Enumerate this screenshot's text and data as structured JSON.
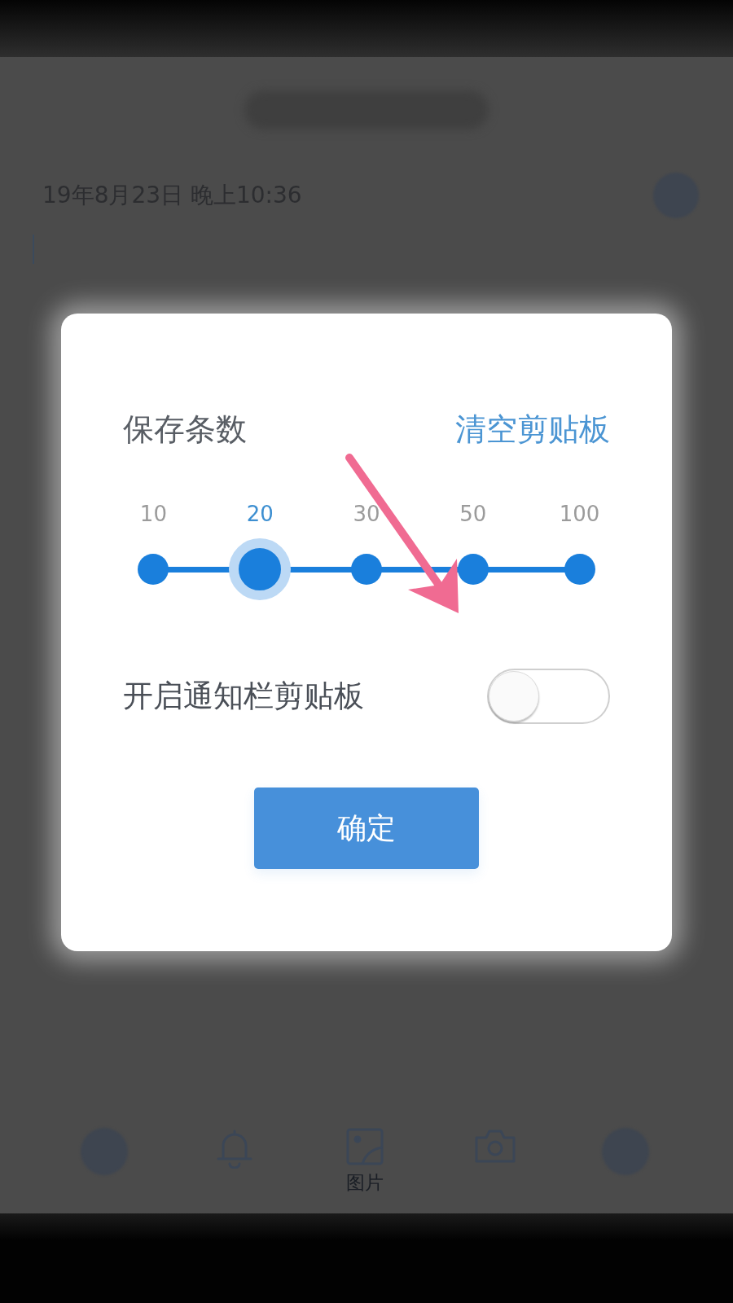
{
  "page": {
    "timestamp": "19年8月23日 晚上10:36"
  },
  "dialog": {
    "title": "保存条数",
    "clear_link": "清空剪贴板",
    "slider": {
      "options": [
        {
          "label": "10",
          "selected": false
        },
        {
          "label": "20",
          "selected": true
        },
        {
          "label": "30",
          "selected": false
        },
        {
          "label": "50",
          "selected": false
        },
        {
          "label": "100",
          "selected": false
        }
      ]
    },
    "notification_toggle": {
      "label": "开启通知栏剪贴板",
      "on": false
    },
    "confirm_button": "确定"
  },
  "bottom_toolbar": {
    "image_label": "图片"
  }
}
